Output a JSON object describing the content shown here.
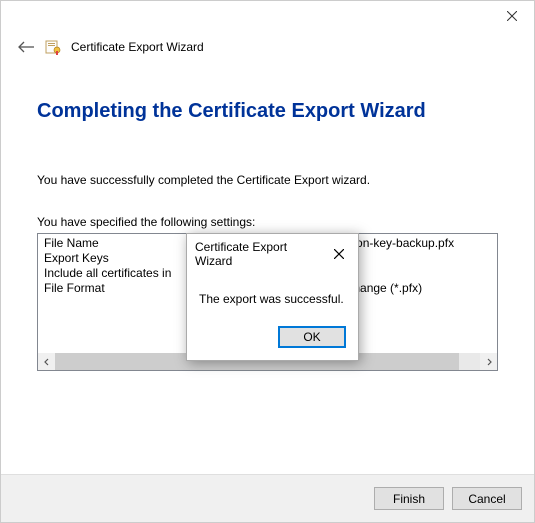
{
  "window": {
    "header_title": "Certificate Export Wizard"
  },
  "page": {
    "title": "Completing the Certificate Export Wizard",
    "intro": "You have successfully completed the Certificate Export wizard.",
    "settings_label": "You have specified the following settings:",
    "rows": [
      {
        "label": "File Name",
        "value": "E:\\certification-key-backup.pfx"
      },
      {
        "label": "Export Keys",
        "value": ""
      },
      {
        "label": "Include all certificates in",
        "value": ""
      },
      {
        "label": "File Format",
        "value": "mation Exchange (*.pfx)"
      }
    ]
  },
  "dialog": {
    "title": "Certificate Export Wizard",
    "message": "The export was successful.",
    "ok": "OK"
  },
  "buttons": {
    "finish": "Finish",
    "cancel": "Cancel"
  }
}
